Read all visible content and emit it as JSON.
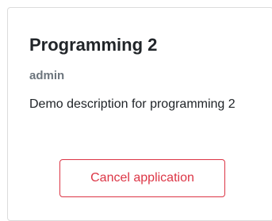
{
  "course": {
    "title": "Programming 2",
    "author": "admin",
    "description": "Demo description for programming 2"
  },
  "actions": {
    "cancel_label": "Cancel application"
  },
  "colors": {
    "danger": "#dc3545",
    "muted": "#6c757d",
    "text": "#212529",
    "border": "#dcdcdc"
  }
}
